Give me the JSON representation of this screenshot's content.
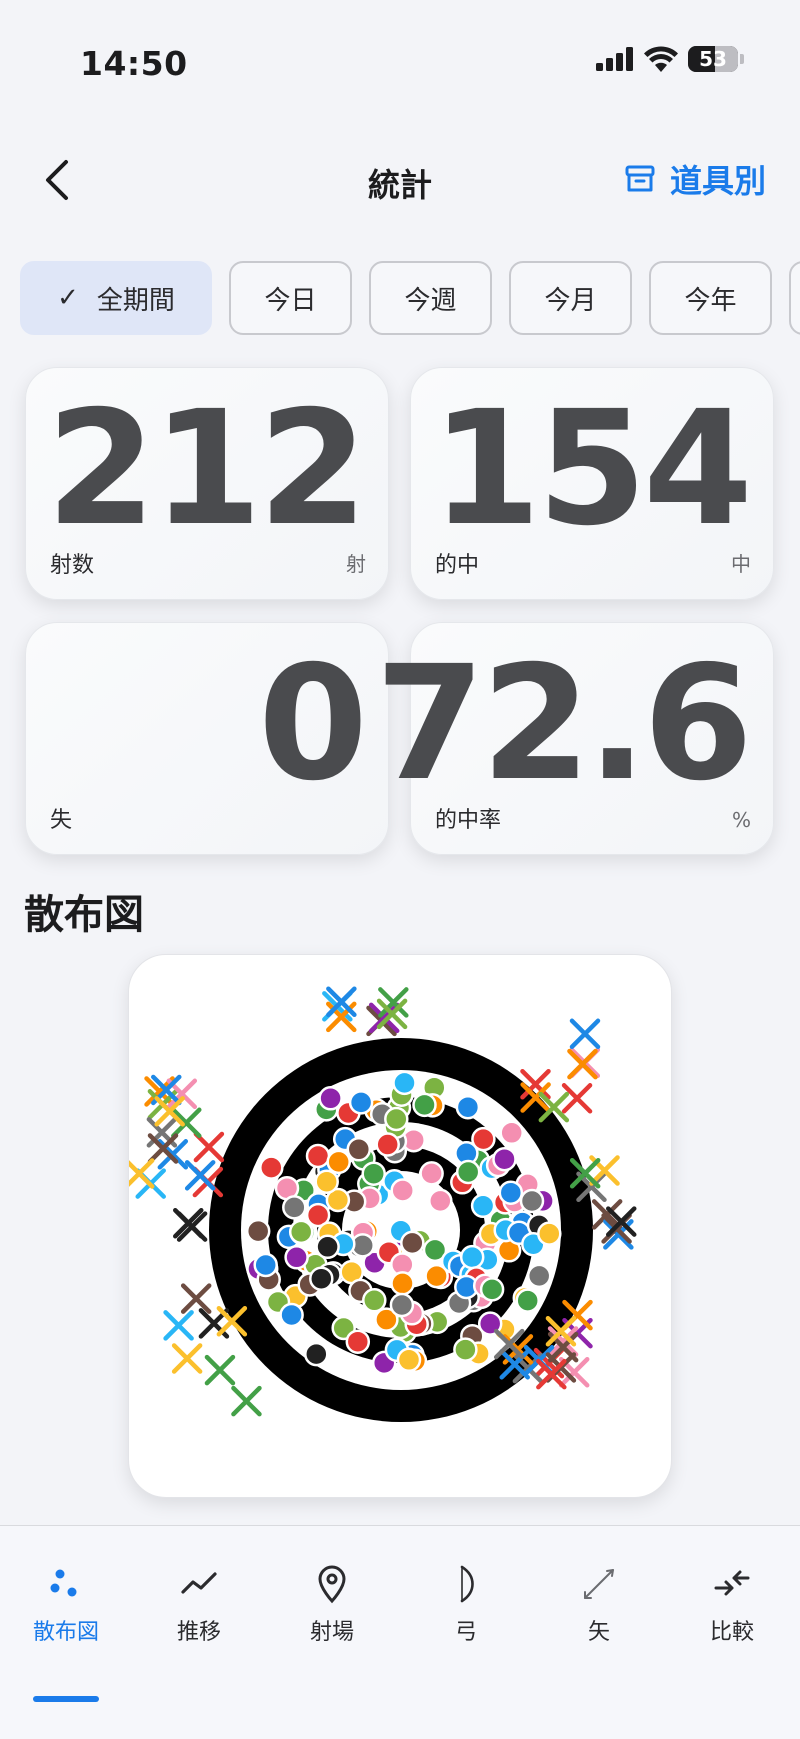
{
  "status": {
    "time": "14:50",
    "battery": "53",
    "battery_level": 0.53
  },
  "nav": {
    "title": "統計",
    "right_label": "道具別"
  },
  "chips": [
    {
      "label": "全期間",
      "active": true
    },
    {
      "label": "今日",
      "active": false
    },
    {
      "label": "今週",
      "active": false
    },
    {
      "label": "今月",
      "active": false
    },
    {
      "label": "今年",
      "active": false
    }
  ],
  "stats": {
    "shots": {
      "value": "212",
      "label": "射数",
      "unit": "射"
    },
    "hits": {
      "value": "154",
      "label": "的中",
      "unit": "中"
    },
    "misses": {
      "value": "0",
      "label": "失",
      "unit": ""
    },
    "rate": {
      "value": "72.6",
      "label": "的中率",
      "unit": "%"
    }
  },
  "scatter": {
    "title": "散布図"
  },
  "colors": {
    "accent": "#1a7bea",
    "markers": [
      "#e53935",
      "#1e88e5",
      "#43a047",
      "#fb8c00",
      "#f48fb1",
      "#29b6f6",
      "#7cb342",
      "#fbc02d",
      "#6d4c41",
      "#212121",
      "#8e24aa",
      "#757575"
    ]
  },
  "tabs": [
    {
      "label": "散布図",
      "icon": "scatter-icon",
      "active": true
    },
    {
      "label": "推移",
      "icon": "trend-icon",
      "active": false
    },
    {
      "label": "射場",
      "icon": "location-pin-icon",
      "active": false
    },
    {
      "label": "弓",
      "icon": "bow-icon",
      "active": false
    },
    {
      "label": "矢",
      "icon": "arrow-icon",
      "active": false
    },
    {
      "label": "比較",
      "icon": "compare-icon",
      "active": false
    }
  ]
}
